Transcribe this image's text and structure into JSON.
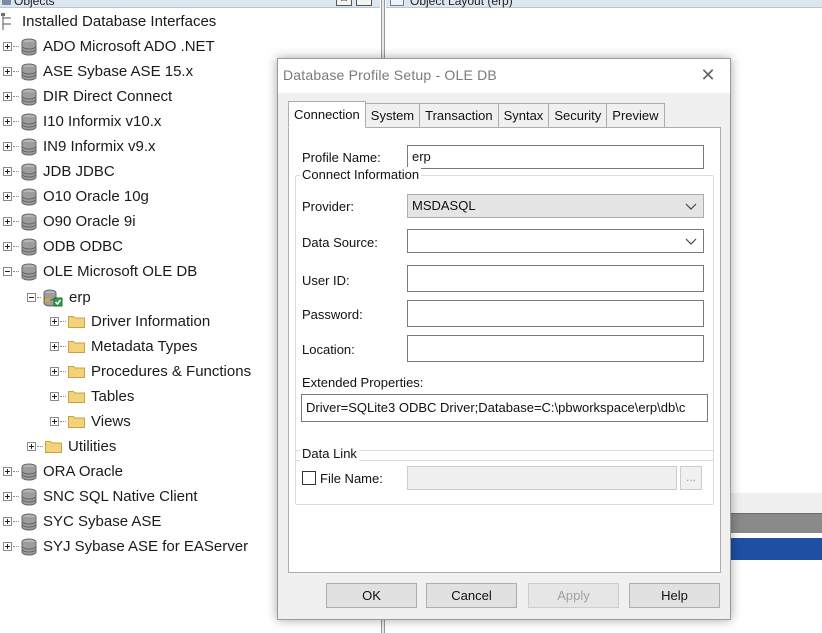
{
  "objects_pane": {
    "title": "Objects",
    "tree": {
      "root_label": "Installed Database Interfaces",
      "interfaces": [
        {
          "label": "ADO Microsoft ADO .NET"
        },
        {
          "label": "ASE Sybase ASE 15.x"
        },
        {
          "label": "DIR Direct Connect"
        },
        {
          "label": "I10 Informix v10.x"
        },
        {
          "label": "IN9 Informix v9.x"
        },
        {
          "label": "JDB JDBC"
        },
        {
          "label": "O10 Oracle 10g"
        },
        {
          "label": "O90 Oracle 9i"
        },
        {
          "label": "ODB ODBC"
        },
        {
          "label": "OLE Microsoft OLE DB"
        },
        {
          "label": "ORA Oracle"
        },
        {
          "label": "SNC SQL Native Client"
        },
        {
          "label": "SYC Sybase ASE"
        },
        {
          "label": "SYJ Sybase ASE for EAServer"
        }
      ],
      "profile_label": "erp",
      "profile_children": [
        {
          "label": "Driver Information"
        },
        {
          "label": "Metadata Types"
        },
        {
          "label": "Procedures & Functions"
        },
        {
          "label": "Tables"
        },
        {
          "label": "Views"
        }
      ],
      "utilities_label": "Utilities"
    }
  },
  "layout_pane": {
    "title": "Object Layout (erp)"
  },
  "dialog": {
    "title": "Database Profile Setup - OLE DB",
    "close_glyph": "✕",
    "tabs": [
      "Connection",
      "System",
      "Transaction",
      "Syntax",
      "Security",
      "Preview"
    ],
    "active_tab": "Connection",
    "connection": {
      "profile_name_label": "Profile Name:",
      "profile_name_value": "erp",
      "connect_info_label": "Connect Information",
      "provider_label": "Provider:",
      "provider_value": "MSDASQL",
      "data_source_label": "Data Source:",
      "data_source_value": "",
      "user_id_label": "User ID:",
      "user_id_value": "",
      "password_label": "Password:",
      "password_value": "",
      "location_label": "Location:",
      "location_value": "",
      "extended_properties_label": "Extended Properties:",
      "extended_properties_value": "Driver=SQLite3 ODBC Driver;Database=C:\\pbworkspace\\erp\\db\\c",
      "data_link_label": "Data Link",
      "file_name_label": "File Name:",
      "file_name_checked": false,
      "browse_label": "..."
    },
    "buttons": {
      "ok": "OK",
      "cancel": "Cancel",
      "apply": "Apply",
      "help": "Help"
    }
  },
  "colors": {
    "header_bg": "#dde6f0",
    "dialog_bg": "#f0f0f0",
    "selection_blue": "#1e4fa3",
    "db_icon": "#8c8c8c",
    "folder_icon": "#e8c56a"
  }
}
